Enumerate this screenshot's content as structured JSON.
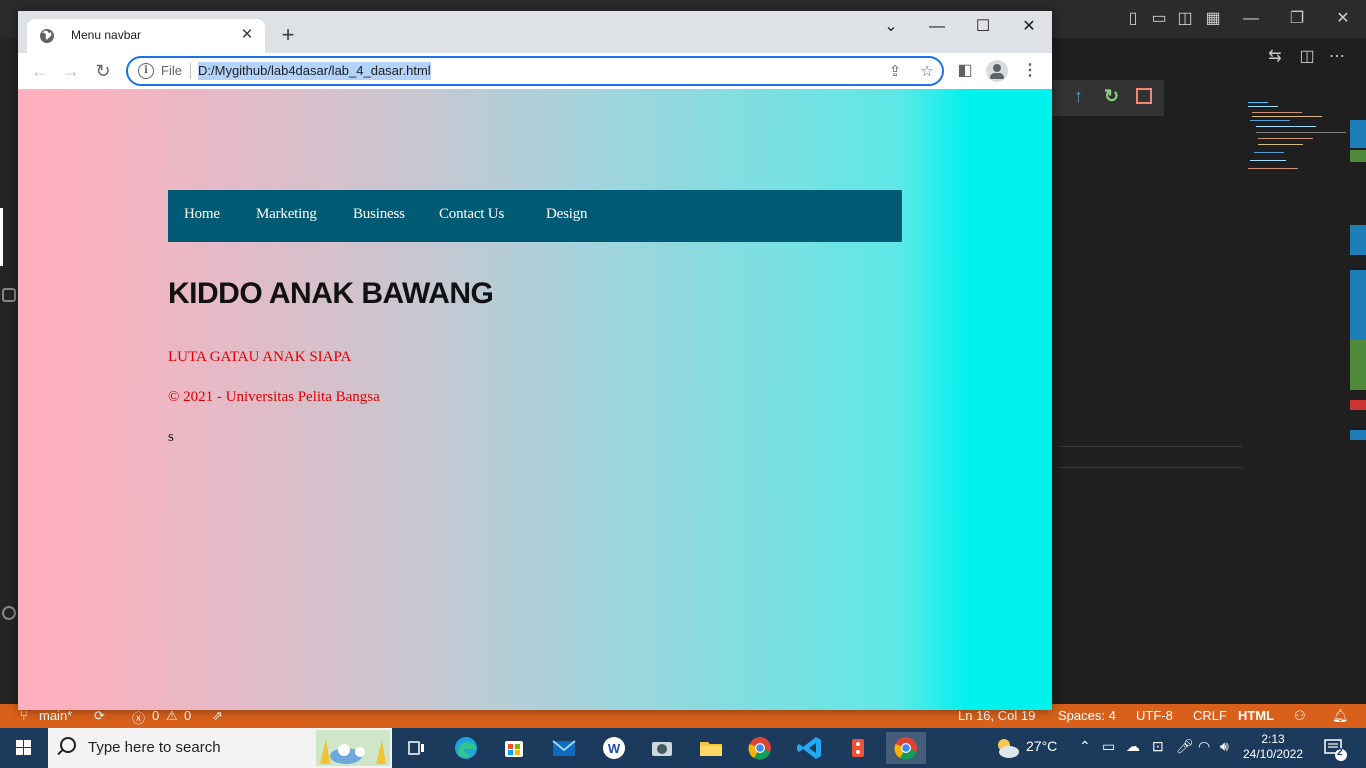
{
  "browser": {
    "tab_title": "Menu navbar",
    "url_scheme": "File",
    "url": "D:/Mygithub/lab4dasar/lab_4_dasar.html"
  },
  "page": {
    "nav_links": [
      "Home",
      "Marketing",
      "Business",
      "Contact Us",
      "Design"
    ],
    "heading": "KIDDO ANAK BAWANG",
    "subtitle": "LUTA GATAU ANAK SIAPA",
    "copyright": "© 2021 - Universitas Pelita Bangsa",
    "extra_text": "s",
    "gradient_colors": [
      "#ffafbd",
      "#00f2ee"
    ],
    "nav_color": "#005a74",
    "text_accent": "#e00000"
  },
  "statusbar": {
    "branch": "main*",
    "errors": "0",
    "warnings": "0",
    "position": "Ln 16, Col 19",
    "indent": "Spaces: 4",
    "encoding": "UTF-8",
    "eol": "CRLF",
    "language": "HTML",
    "color": "#d8601b"
  },
  "taskbar": {
    "search_placeholder": "Type here to search",
    "weather": "27°C",
    "time": "2:13",
    "date": "24/10/2022",
    "notification_count": "2",
    "apps": [
      "task-view-icon",
      "edge-icon",
      "store-icon",
      "mail-icon",
      "word-icon",
      "camera-icon",
      "explorer-icon",
      "chrome-icon",
      "vscode-icon",
      "git-icon",
      "chrome-active-icon"
    ]
  }
}
